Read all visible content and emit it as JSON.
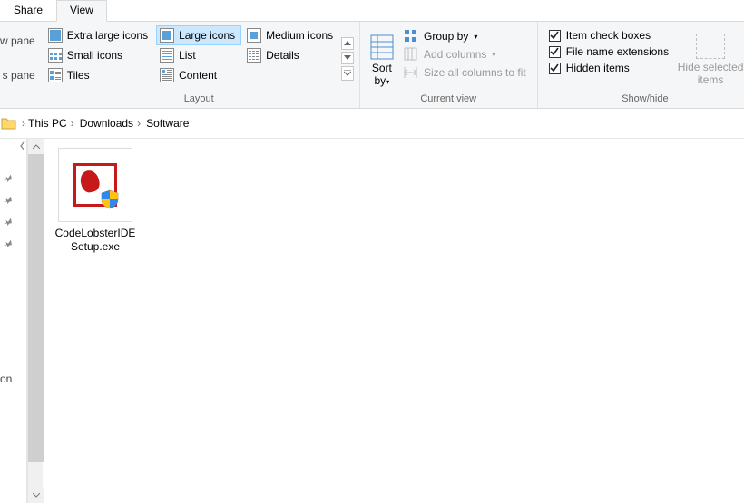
{
  "tabs": {
    "share": "Share",
    "view": "View"
  },
  "leftPartial": {
    "line1": "w pane",
    "line2": "s pane"
  },
  "layout": {
    "items": {
      "xl": "Extra large icons",
      "lg": "Large icons",
      "md": "Medium icons",
      "sm": "Small icons",
      "list": "List",
      "det": "Details",
      "tile": "Tiles",
      "cont": "Content"
    },
    "label": "Layout"
  },
  "currentView": {
    "sortBy": "Sort by",
    "groupBy": "Group by",
    "addColumns": "Add columns",
    "sizeAll": "Size all columns to fit",
    "label": "Current view"
  },
  "showHide": {
    "itemCheck": "Item check boxes",
    "fileExt": "File name extensions",
    "hidden": "Hidden items",
    "hideSel1": "Hide selected",
    "hideSel2": "items",
    "label": "Show/hide"
  },
  "breadcrumb": {
    "thispc": "This PC",
    "downloads": "Downloads",
    "software": "Software"
  },
  "navPartial": {
    "rson": "rson"
  },
  "files": [
    {
      "name": "CodeLobsterIDESetup.exe"
    }
  ]
}
